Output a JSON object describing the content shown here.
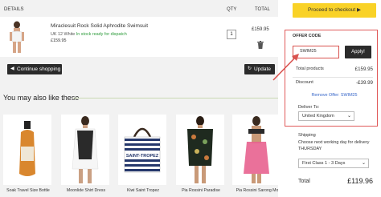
{
  "cart": {
    "headers": {
      "details": "DETAILS",
      "qty": "QTY",
      "total": "TOTAL"
    },
    "item": {
      "name": "Miraclesuit Rock Solid Aphrodite Swimsuit",
      "size_colour": "UK 12  White",
      "stock": "In stock ready for dispatch",
      "price": "£159.95",
      "qty": "1",
      "line_total": "£159.95"
    },
    "continue_label": "Continue shopping",
    "update_label": "Update"
  },
  "recommendations": {
    "title": "You may also like these",
    "items": [
      {
        "caption": "Soak Travel Size Bottle"
      },
      {
        "caption": "Moonlide Shirt Dress"
      },
      {
        "caption": "Kiwi Saint Tropez"
      },
      {
        "caption": "Pia Rossini Paradise"
      },
      {
        "caption": "Pia Rossini Sarong Mo"
      }
    ],
    "tote_text": "SAINT-TROPEZ"
  },
  "summary": {
    "checkout_label": "Proceed to checkout",
    "offer_label": "OFFER CODE",
    "voucher_value": "SWIM25",
    "apply_label": "Apply!",
    "total_products_label": "Total products",
    "total_products_value": "£159.95",
    "discount_label": "Discount",
    "discount_value": "-£39.99",
    "remove_offer_label": "Remove Offer: SWIM25",
    "deliver_to_label": "Deliver To:",
    "country": "United Kingdom",
    "shipping_label": "Shipping",
    "shipping_note": "Choose next working day for delivery THURSDAY",
    "shipping_option": "First Class 1 - 3 Days",
    "total_label": "Total",
    "total_value": "£119.96"
  },
  "colors": {
    "checkout": "#f9d227",
    "highlight": "#e05a5a",
    "dark_button": "#2b2b2b",
    "link": "#3666c9"
  }
}
